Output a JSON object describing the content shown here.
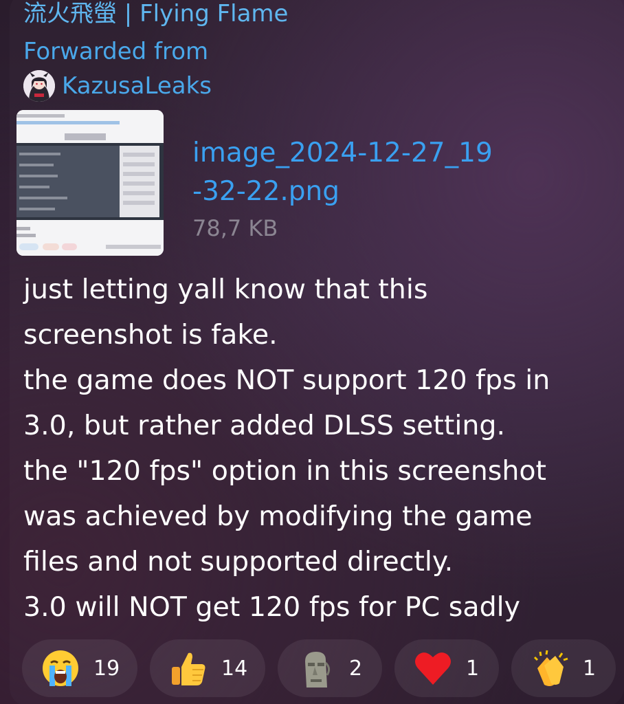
{
  "channel": {
    "title": "流火飛螢 | Flying Flame"
  },
  "forward": {
    "label": "Forwarded from",
    "source": "KazusaLeaks"
  },
  "attachment": {
    "file_name_line1": "image_2024-12-27_19",
    "file_name_line2": "-32-22.png",
    "file_size": "78,7 KB"
  },
  "message": {
    "lines": [
      "just letting yall know that this",
      "screenshot is fake.",
      "the game does NOT support 120 fps in",
      "3.0, but rather added DLSS setting.",
      "the \"120 fps\" option in this screenshot",
      "was achieved by modifying the game",
      "files and not supported directly.",
      "3.0 will NOT get 120 fps for PC sadly"
    ]
  },
  "reactions": [
    {
      "emoji": "crying-face-icon",
      "count": "19"
    },
    {
      "emoji": "thumbs-up-icon",
      "count": "14"
    },
    {
      "emoji": "moai-icon",
      "count": "2"
    },
    {
      "emoji": "red-heart-icon",
      "count": "1"
    },
    {
      "emoji": "clapping-hands-icon",
      "count": "1"
    }
  ],
  "colors": {
    "link_blue": "#4aa8ea",
    "file_blue": "#3aa0f0",
    "meta_grey": "#8b8592",
    "text": "#ffffff"
  }
}
